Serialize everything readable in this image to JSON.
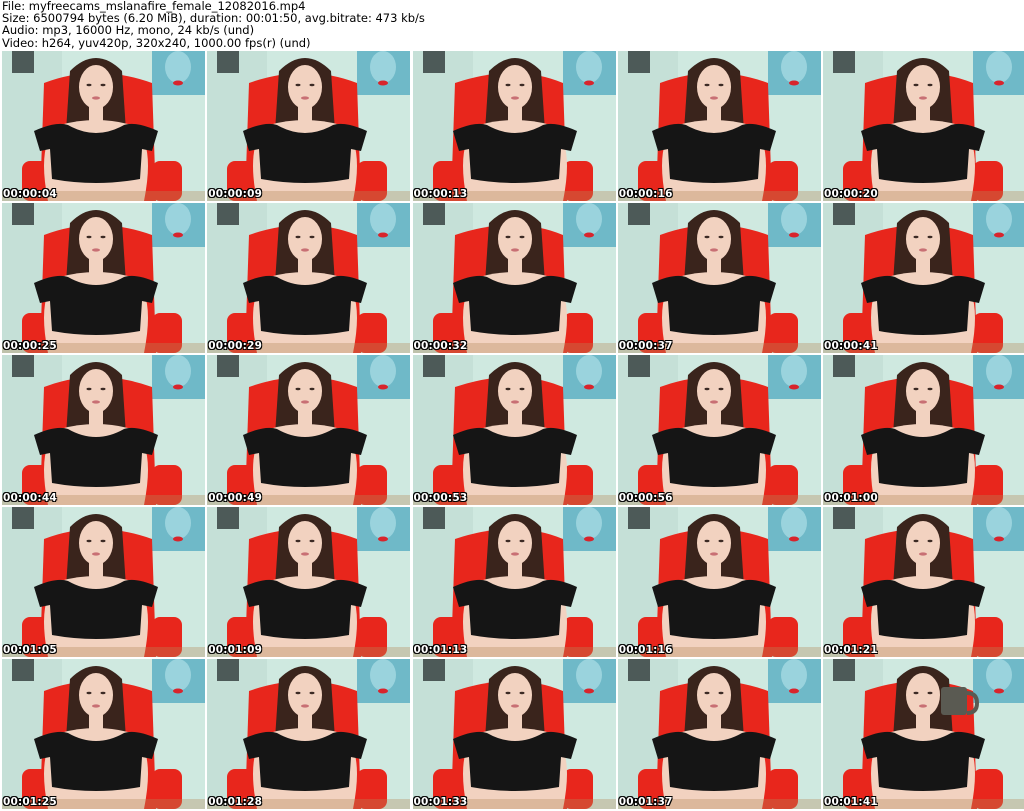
{
  "header": {
    "file_line": "File: myfreecams_mslanafire_female_12082016.mp4",
    "size_line": "Size: 6500794 bytes (6.20 MiB), duration: 00:01:50, avg.bitrate: 473 kb/s",
    "audio_line": "Audio: mp3, 16000 Hz, mono, 24 kb/s (und)",
    "video_line": "Video: h264, yuv420p, 320x240, 1000.00 fps(r) (und)"
  },
  "thumbnails": [
    {
      "timestamp": "00:00:04"
    },
    {
      "timestamp": "00:00:09"
    },
    {
      "timestamp": "00:00:13"
    },
    {
      "timestamp": "00:00:16"
    },
    {
      "timestamp": "00:00:20"
    },
    {
      "timestamp": "00:00:25"
    },
    {
      "timestamp": "00:00:29"
    },
    {
      "timestamp": "00:00:32"
    },
    {
      "timestamp": "00:00:37"
    },
    {
      "timestamp": "00:00:41"
    },
    {
      "timestamp": "00:00:44"
    },
    {
      "timestamp": "00:00:49"
    },
    {
      "timestamp": "00:00:53"
    },
    {
      "timestamp": "00:00:56"
    },
    {
      "timestamp": "00:01:00"
    },
    {
      "timestamp": "00:01:05"
    },
    {
      "timestamp": "00:01:09"
    },
    {
      "timestamp": "00:01:13"
    },
    {
      "timestamp": "00:01:16"
    },
    {
      "timestamp": "00:01:21"
    },
    {
      "timestamp": "00:01:25"
    },
    {
      "timestamp": "00:01:28"
    },
    {
      "timestamp": "00:01:33"
    },
    {
      "timestamp": "00:01:37"
    },
    {
      "timestamp": "00:01:41",
      "mug": true
    }
  ],
  "colors": {
    "wall": "#cfe9e0",
    "chair": "#e8261c",
    "hair": "#3a241c",
    "skin": "#f2d2c0",
    "top": "#151515",
    "poster": "#6fb9c8",
    "lips": "#d8242c",
    "mug": "#5a5a52"
  }
}
